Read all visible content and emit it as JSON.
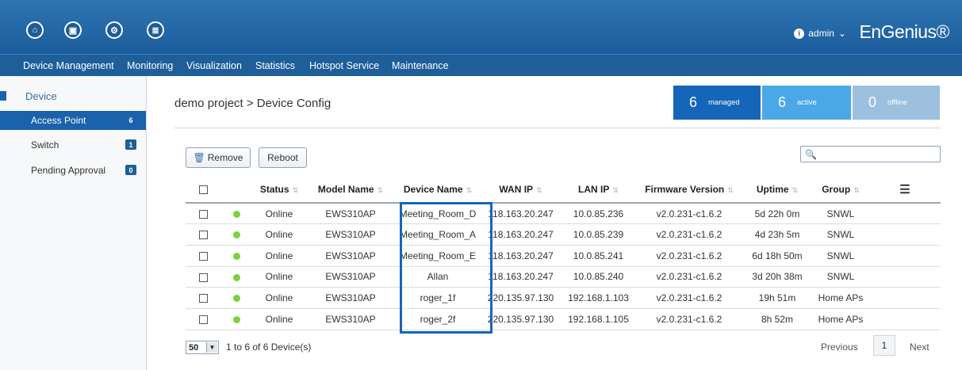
{
  "topbar": {
    "icons": [
      "home-icon",
      "dashboard-icon",
      "gear-icon",
      "clipboard-icon"
    ],
    "admin_label": "admin",
    "logo": "EnGenius®"
  },
  "nav": [
    "Device Management",
    "Monitoring",
    "Visualization",
    "Statistics",
    "Hotspot Service",
    "Maintenance"
  ],
  "sidebar": {
    "section": "Device",
    "items": [
      {
        "label": "Access Point",
        "count": "6"
      },
      {
        "label": "Switch",
        "count": "1"
      },
      {
        "label": "Pending Approval",
        "count": "0"
      }
    ]
  },
  "page_title": "demo project > Device Config",
  "stats": [
    {
      "num": "6",
      "label": "managed",
      "color": "#1565b8"
    },
    {
      "num": "6",
      "label": "active",
      "color": "#4aa8e8"
    },
    {
      "num": "0",
      "label": "offline",
      "color": "#9cc0de"
    }
  ],
  "toolbar": {
    "remove_label": "Remove",
    "reboot_label": "Reboot",
    "search_placeholder": ""
  },
  "table": {
    "headers": [
      "Status",
      "Model Name",
      "Device Name",
      "WAN IP",
      "LAN IP",
      "Firmware Version",
      "Uptime",
      "Group"
    ],
    "rows": [
      {
        "status": "Online",
        "model": "EWS310AP",
        "device": "Meeting_Room_D",
        "wan": "118.163.20.247",
        "lan": "10.0.85.236",
        "fw": "v2.0.231-c1.6.2",
        "uptime": "5d 22h 0m",
        "group": "SNWL"
      },
      {
        "status": "Online",
        "model": "EWS310AP",
        "device": "Meeting_Room_A",
        "wan": "118.163.20.247",
        "lan": "10.0.85.239",
        "fw": "v2.0.231-c1.6.2",
        "uptime": "4d 23h 5m",
        "group": "SNWL"
      },
      {
        "status": "Online",
        "model": "EWS310AP",
        "device": "Meeting_Room_E",
        "wan": "118.163.20.247",
        "lan": "10.0.85.241",
        "fw": "v2.0.231-c1.6.2",
        "uptime": "6d 18h 50m",
        "group": "SNWL"
      },
      {
        "status": "Online",
        "model": "EWS310AP",
        "device": "Allan",
        "wan": "118.163.20.247",
        "lan": "10.0.85.240",
        "fw": "v2.0.231-c1.6.2",
        "uptime": "3d 20h 38m",
        "group": "SNWL"
      },
      {
        "status": "Online",
        "model": "EWS310AP",
        "device": "roger_1f",
        "wan": "220.135.97.130",
        "lan": "192.168.1.103",
        "fw": "v2.0.231-c1.6.2",
        "uptime": "19h 51m",
        "group": "Home APs"
      },
      {
        "status": "Online",
        "model": "EWS310AP",
        "device": "roger_2f",
        "wan": "220.135.97.130",
        "lan": "192.168.1.105",
        "fw": "v2.0.231-c1.6.2",
        "uptime": "8h 52m",
        "group": "Home APs"
      }
    ]
  },
  "footer": {
    "page_size": "50",
    "count_text": "1 to 6 of 6 Device(s)",
    "previous": "Previous",
    "page": "1",
    "next": "Next"
  }
}
